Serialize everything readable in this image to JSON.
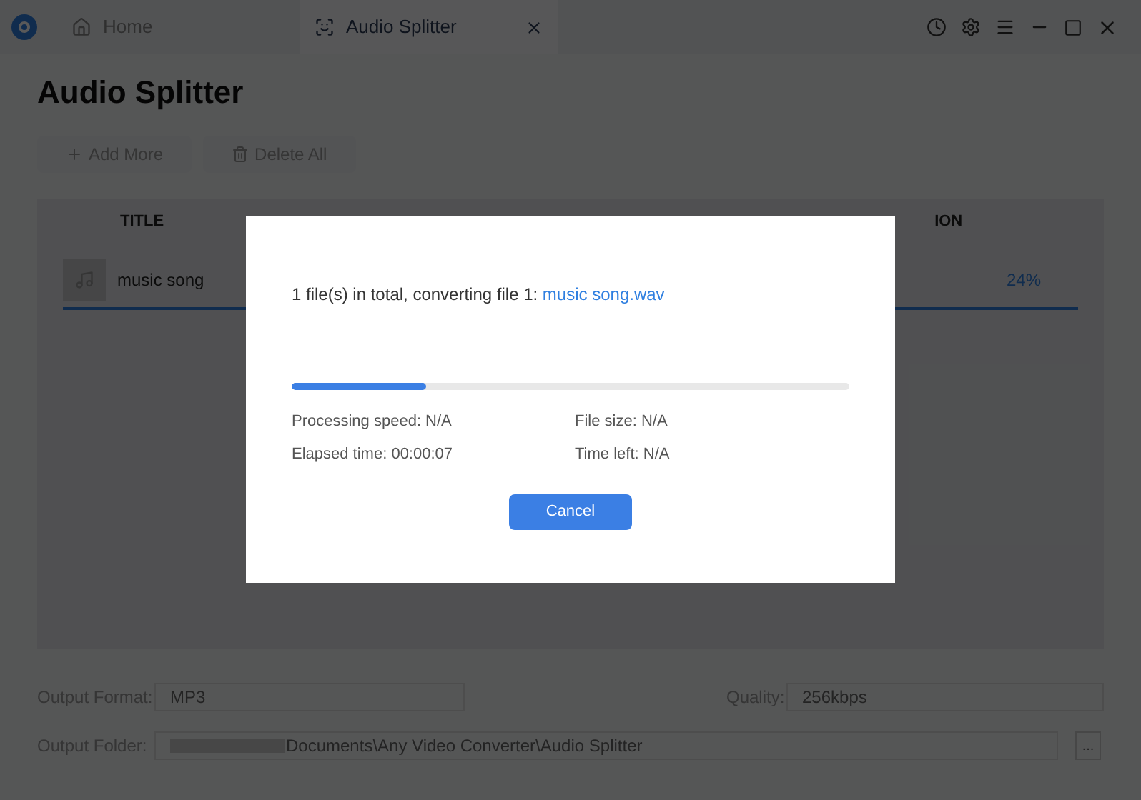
{
  "window": {
    "tabs": [
      {
        "label": "Home",
        "selected": false,
        "closable": false
      },
      {
        "label": "Audio Splitter",
        "selected": true,
        "closable": true
      }
    ]
  },
  "page": {
    "title": "Audio Splitter"
  },
  "toolbar": {
    "buttons": [
      {
        "label": "Add More",
        "kind": "add"
      },
      {
        "label": "Delete All",
        "kind": "delete"
      }
    ]
  },
  "table": {
    "columns": [
      "TITLE",
      "ION"
    ],
    "rows": [
      {
        "title": "music song",
        "progress": "24%",
        "selected": true
      }
    ]
  },
  "settings": {
    "output_format_label": "Output Format:",
    "output_format": "MP3",
    "quality_label": "Quality:",
    "quality": "256kbps",
    "output_folder_label": "Output Folder:",
    "output_folder": "Documents\\Any Video Converter\\Audio Splitter",
    "browse": "..."
  },
  "dialog": {
    "message": "1 file(s) in total, converting file 1: ",
    "file": "music song.wav",
    "level": 0.24,
    "stats": [
      "Processing speed: N/A",
      "File size: N/A",
      "Elapsed time: 00:00:07",
      "Time left: N/A"
    ],
    "cancel": "Cancel"
  }
}
